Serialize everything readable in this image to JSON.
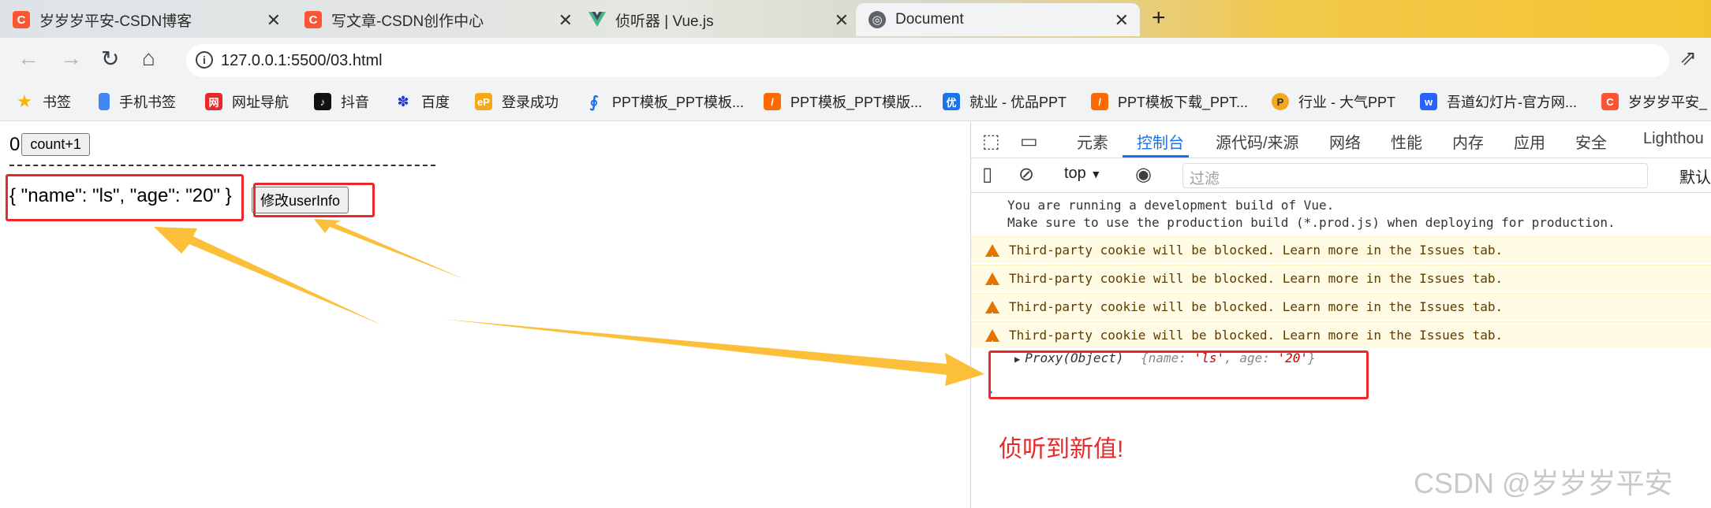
{
  "tabs": [
    {
      "title": "岁岁岁平安-CSDN博客",
      "icon": "csdn-icon",
      "color": "#fc5531"
    },
    {
      "title": "写文章-CSDN创作中心",
      "icon": "csdn-icon",
      "color": "#fc5531"
    },
    {
      "title": "侦听器 | Vue.js",
      "icon": "vue-icon",
      "color": "#42b883"
    },
    {
      "title": "Document",
      "icon": "globe-icon",
      "color": "#5f6368"
    }
  ],
  "address": {
    "url": "127.0.0.1:5500/03.html"
  },
  "bookmarks": [
    {
      "label": "书签",
      "icon": "star-icon",
      "color": "#f4b400"
    },
    {
      "label": "手机书签",
      "icon": "phone-icon",
      "color": "#4285f4"
    },
    {
      "label": "网址导航",
      "icon": "nav-icon",
      "color": "#e8282b"
    },
    {
      "label": "抖音",
      "icon": "douyin-icon",
      "color": "#111111"
    },
    {
      "label": "百度",
      "icon": "baidu-icon",
      "color": "#2932e1"
    },
    {
      "label": "登录成功",
      "icon": "ep-icon",
      "color": "#f4a81d"
    },
    {
      "label": "PPT模板_PPT模板...",
      "icon": "ppt-icon",
      "color": "#1a73e8"
    },
    {
      "label": "PPT模板_PPT模版...",
      "icon": "ppt-icon",
      "color": "#ff6a00"
    },
    {
      "label": "就业 - 优品PPT",
      "icon": "youpin-icon",
      "color": "#1a73e8"
    },
    {
      "label": "PPT模板下载_PPT...",
      "icon": "ppt-icon",
      "color": "#ff6a00"
    },
    {
      "label": "行业 - 大气PPT",
      "icon": "p-icon",
      "color": "#f4a81d"
    },
    {
      "label": "吾道幻灯片-官方网...",
      "icon": "wudao-icon",
      "color": "#2962ff"
    },
    {
      "label": "岁岁岁平安_",
      "icon": "csdn-icon",
      "color": "#fc5531"
    }
  ],
  "page": {
    "count_value": "0",
    "count_button": "count+1",
    "dash_line": "------------------------------------------------",
    "user_json": "{ \"name\": \"ls\", \"age\": \"20\" }",
    "modify_button": "修改userInfo"
  },
  "devtools": {
    "tabs": [
      "元素",
      "控制台",
      "源代码/来源",
      "网络",
      "性能",
      "内存",
      "应用",
      "安全",
      "Lighthou"
    ],
    "active_tab": "控制台",
    "context": "top",
    "filter_placeholder": "过滤",
    "levels": "默认",
    "console": {
      "info_line1": "You are running a development build of Vue.",
      "info_line2": "Make sure to use the production build (*.prod.js) when deploying for production.",
      "warnings": [
        "Third-party cookie will be blocked. Learn more in the Issues tab.",
        "Third-party cookie will be blocked. Learn more in the Issues tab.",
        "Third-party cookie will be blocked. Learn more in the Issues tab.",
        "Third-party cookie will be blocked. Learn more in the Issues tab."
      ],
      "proxy_label": "Proxy(Object)",
      "proxy_open": "{name: ",
      "proxy_name": "'ls'",
      "proxy_mid": ", age: ",
      "proxy_age": "'20'",
      "proxy_close": "}",
      "prompt": "›"
    }
  },
  "annotation": {
    "caption": "侦听到新值!",
    "watermark": "CSDN @岁岁岁平安"
  },
  "colors": {
    "annotation_red": "#e8282b",
    "arrow_yellow": "#fbbf3a",
    "active_blue": "#1a73e8"
  }
}
